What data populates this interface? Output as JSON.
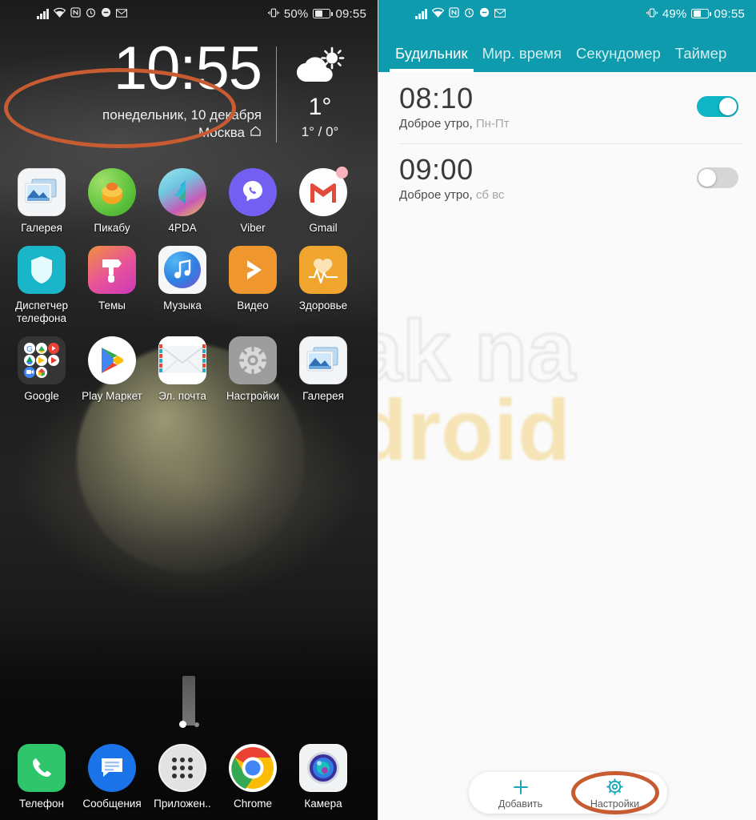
{
  "home": {
    "status_bar": {
      "icons": [
        "signal-icon",
        "wifi-icon",
        "nfc-icon",
        "alarm-icon",
        "do-not-disturb-icon",
        "gmail-icon"
      ],
      "vibrate_icon": "vibrate-icon",
      "battery_percent": "50%",
      "time": "09:55"
    },
    "widget": {
      "time": "10:55",
      "date": "понедельник, 10 декабря",
      "city": "Москва",
      "home_icon": "home-icon",
      "weather_icon": "sun-behind-cloud-icon",
      "temp": "1°",
      "temp_range": "1° / 0°"
    },
    "rows": [
      [
        {
          "label": "Галерея",
          "icon": "gallery-icon"
        },
        {
          "label": "Пикабу",
          "icon": "pikabu-icon"
        },
        {
          "label": "4PDA",
          "icon": "fourpda-icon"
        },
        {
          "label": "Viber",
          "icon": "viber-icon"
        },
        {
          "label": "Gmail",
          "icon": "gmail-icon",
          "badge": true
        }
      ],
      [
        {
          "label": "Диспетчер телефона",
          "icon": "phone-manager-icon"
        },
        {
          "label": "Темы",
          "icon": "themes-icon"
        },
        {
          "label": "Музыка",
          "icon": "music-icon"
        },
        {
          "label": "Видео",
          "icon": "video-icon"
        },
        {
          "label": "Здоровье",
          "icon": "health-icon"
        }
      ],
      [
        {
          "label": "Google",
          "icon": "google-folder-icon"
        },
        {
          "label": "Play Маркет",
          "icon": "play-store-icon"
        },
        {
          "label": "Эл. почта",
          "icon": "email-icon"
        },
        {
          "label": "Настройки",
          "icon": "settings-gear-icon"
        },
        {
          "label": "Галерея",
          "icon": "gallery-icon"
        }
      ]
    ],
    "dock": [
      {
        "label": "Телефон",
        "icon": "phone-icon"
      },
      {
        "label": "Сообщения",
        "icon": "messages-icon"
      },
      {
        "label": "Приложен..",
        "icon": "app-drawer-icon"
      },
      {
        "label": "Chrome",
        "icon": "chrome-icon"
      },
      {
        "label": "Камера",
        "icon": "camera-icon"
      }
    ],
    "page_dots": 2,
    "active_page": 1
  },
  "clock_app": {
    "status_bar": {
      "vibrate_icon": "vibrate-icon",
      "battery_percent": "49%",
      "time": "09:55"
    },
    "tabs": [
      {
        "label": "Будильник",
        "active": true
      },
      {
        "label": "Мир. время",
        "active": false
      },
      {
        "label": "Секундомер",
        "active": false
      },
      {
        "label": "Таймер",
        "active": false
      }
    ],
    "alarms": [
      {
        "time": "08:10",
        "name": "Доброе утро,",
        "days": "Пн-Пт",
        "enabled": true
      },
      {
        "time": "09:00",
        "name": "Доброе утро,",
        "days": "сб вс",
        "enabled": false
      }
    ],
    "bottom_bar": [
      {
        "label": "Добавить",
        "icon": "plus-icon"
      },
      {
        "label": "Настройки",
        "icon": "gear-icon"
      }
    ],
    "watermark_line1": "ak na",
    "watermark_line2": "droid"
  },
  "annotations": {
    "color": "#c75b32",
    "targets": [
      "home-clock-widget",
      "clock-settings-button"
    ]
  },
  "colors": {
    "teal": "#0f9bae",
    "toggle_on": "#0fb5c4",
    "accent_orange": "#c75b32"
  }
}
